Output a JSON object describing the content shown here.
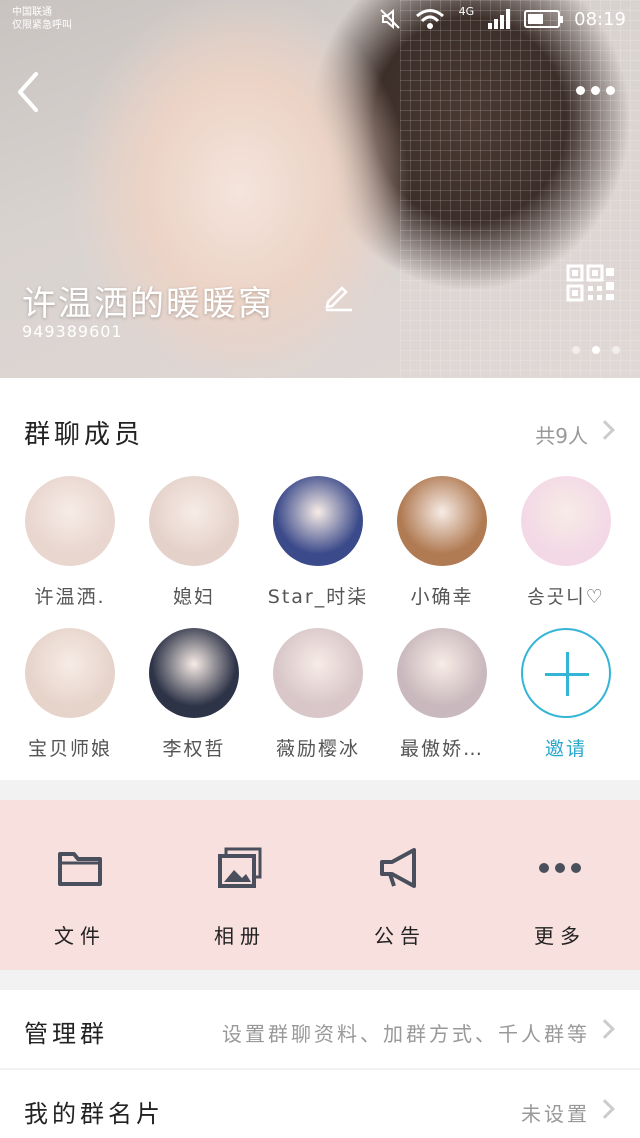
{
  "status_bar": {
    "carrier_line1": "中国联通",
    "carrier_line2": "仅限紧急呼叫",
    "network": "4G",
    "time": "08:19"
  },
  "group": {
    "name": "许温洒的暖暖窝",
    "id": "949389601",
    "carousel_pages": 3,
    "carousel_active": 2
  },
  "members": {
    "title": "群聊成员",
    "count": "共9人",
    "list": [
      {
        "name": "许温洒.",
        "color": "#e8d6cf"
      },
      {
        "name": "媳妇",
        "color": "#e4d2ca"
      },
      {
        "name": "Star_时柒",
        "color": "#3b4a8a"
      },
      {
        "name": "小确幸",
        "color": "#b07a52"
      },
      {
        "name": "송곳니♡",
        "color": "#f3d9e6"
      },
      {
        "name": "宝贝师娘",
        "color": "#e6d4cb"
      },
      {
        "name": "李权哲",
        "color": "#2e3448"
      },
      {
        "name": "薇励樱冰",
        "color": "#d8c6c8"
      },
      {
        "name": "最傲娇…",
        "color": "#c9b8bd"
      }
    ],
    "invite_label": "邀请",
    "invite_color": "#35b5d6"
  },
  "actions": [
    {
      "label": "文件",
      "icon": "folder-icon"
    },
    {
      "label": "相册",
      "icon": "album-icon"
    },
    {
      "label": "公告",
      "icon": "announcement-icon"
    },
    {
      "label": "更多",
      "icon": "more-icon"
    }
  ],
  "rows": {
    "manage": {
      "label": "管理群",
      "value": "设置群聊资料、加群方式、千人群等"
    },
    "card": {
      "label": "我的群名片",
      "value": "未设置"
    }
  }
}
